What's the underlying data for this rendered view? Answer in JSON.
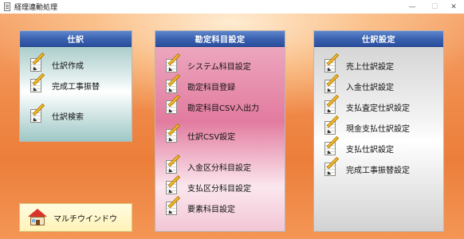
{
  "window": {
    "title": "経理連動処理",
    "minimize": "—",
    "maximize": "☐",
    "close": "✕"
  },
  "panels": [
    {
      "title": "仕訳",
      "items": [
        "仕訳作成",
        "完成工事振替",
        "仕訳検索"
      ]
    },
    {
      "title": "勘定科目設定",
      "items": [
        "システム科目設定",
        "勘定科目登録",
        "勘定科目CSV入出力",
        "仕訳CSV設定",
        "入金区分科目設定",
        "支払区分科目設定",
        "要素科目設定"
      ]
    },
    {
      "title": "仕訳設定",
      "items": [
        "売上仕訳設定",
        "入金仕訳設定",
        "支払査定仕訳設定",
        "現金支払仕訳設定",
        "支払仕訳設定",
        "完成工事振替設定"
      ]
    }
  ],
  "multi_window": {
    "label": "マルチウインドウ"
  },
  "icons": {
    "item": "pencil-notepad-icon",
    "multi": "house-icon",
    "app": "document-icon"
  }
}
